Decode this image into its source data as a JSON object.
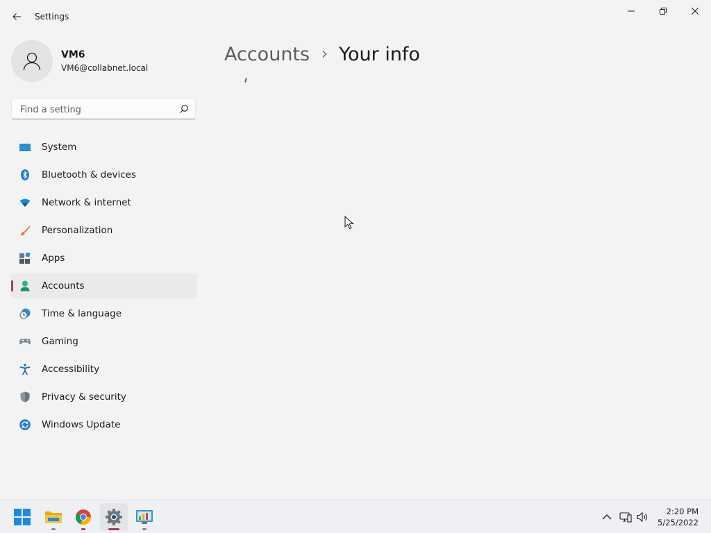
{
  "window": {
    "title": "Settings"
  },
  "profile": {
    "name": "VM6",
    "email": "VM6@collabnet.local"
  },
  "search": {
    "placeholder": "Find a setting"
  },
  "sidebar": {
    "items": [
      {
        "label": "System",
        "icon": "system-icon"
      },
      {
        "label": "Bluetooth & devices",
        "icon": "bluetooth-icon"
      },
      {
        "label": "Network & internet",
        "icon": "wifi-icon"
      },
      {
        "label": "Personalization",
        "icon": "brush-icon"
      },
      {
        "label": "Apps",
        "icon": "apps-icon"
      },
      {
        "label": "Accounts",
        "icon": "accounts-icon",
        "selected": true
      },
      {
        "label": "Time & language",
        "icon": "clock-globe-icon"
      },
      {
        "label": "Gaming",
        "icon": "gamepad-icon"
      },
      {
        "label": "Accessibility",
        "icon": "accessibility-icon"
      },
      {
        "label": "Privacy & security",
        "icon": "shield-icon"
      },
      {
        "label": "Windows Update",
        "icon": "update-icon"
      }
    ]
  },
  "main": {
    "breadcrumb_parent": "Accounts",
    "breadcrumb_current": "Your info"
  },
  "taskbar": {
    "apps": [
      "start-icon",
      "file-explorer-icon",
      "chrome-icon",
      "settings-icon",
      "control-panel-icon"
    ],
    "time": "2:20 PM",
    "date": "5/25/2022"
  },
  "colors": {
    "accent": "#a0434e",
    "background": "#f3f3f3",
    "selected_item": "#eaeaea"
  }
}
